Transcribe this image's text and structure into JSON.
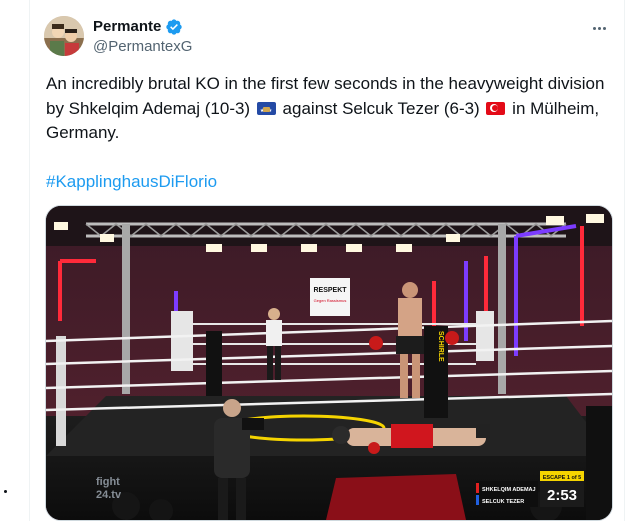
{
  "tweet": {
    "author_name": "Permante",
    "author_handle": "@PermantexG",
    "text_part1": "An incredibly brutal KO in the first few seconds in the heavyweight division by Shkelqim Ademaj (10-3)",
    "text_part2": " against Selcuk Tezer (6-3) ",
    "text_part3": " in Mülheim, Germany.",
    "hashtag": "#KapplinghausDiFlorio",
    "flags": [
      "kosovo-flag-icon",
      "turkey-flag-icon"
    ]
  },
  "media": {
    "banner": "RESPEKT",
    "banner_sub": "Gegen Rassismus",
    "watermark_line1": "fight",
    "watermark_line2": "24.tv",
    "ring_text": "SCHIRLE",
    "scoreboard": {
      "round": "ESCAPE 1 of 5",
      "fighter1": "SHKELQIM ADEMAJ",
      "fighter2": "SELCUK TEZER",
      "time": "2:53"
    }
  },
  "colors": {
    "accent": "#1d9bf0",
    "verified": "#1d9bf0",
    "text": "#0f1419",
    "muted": "#536471"
  }
}
